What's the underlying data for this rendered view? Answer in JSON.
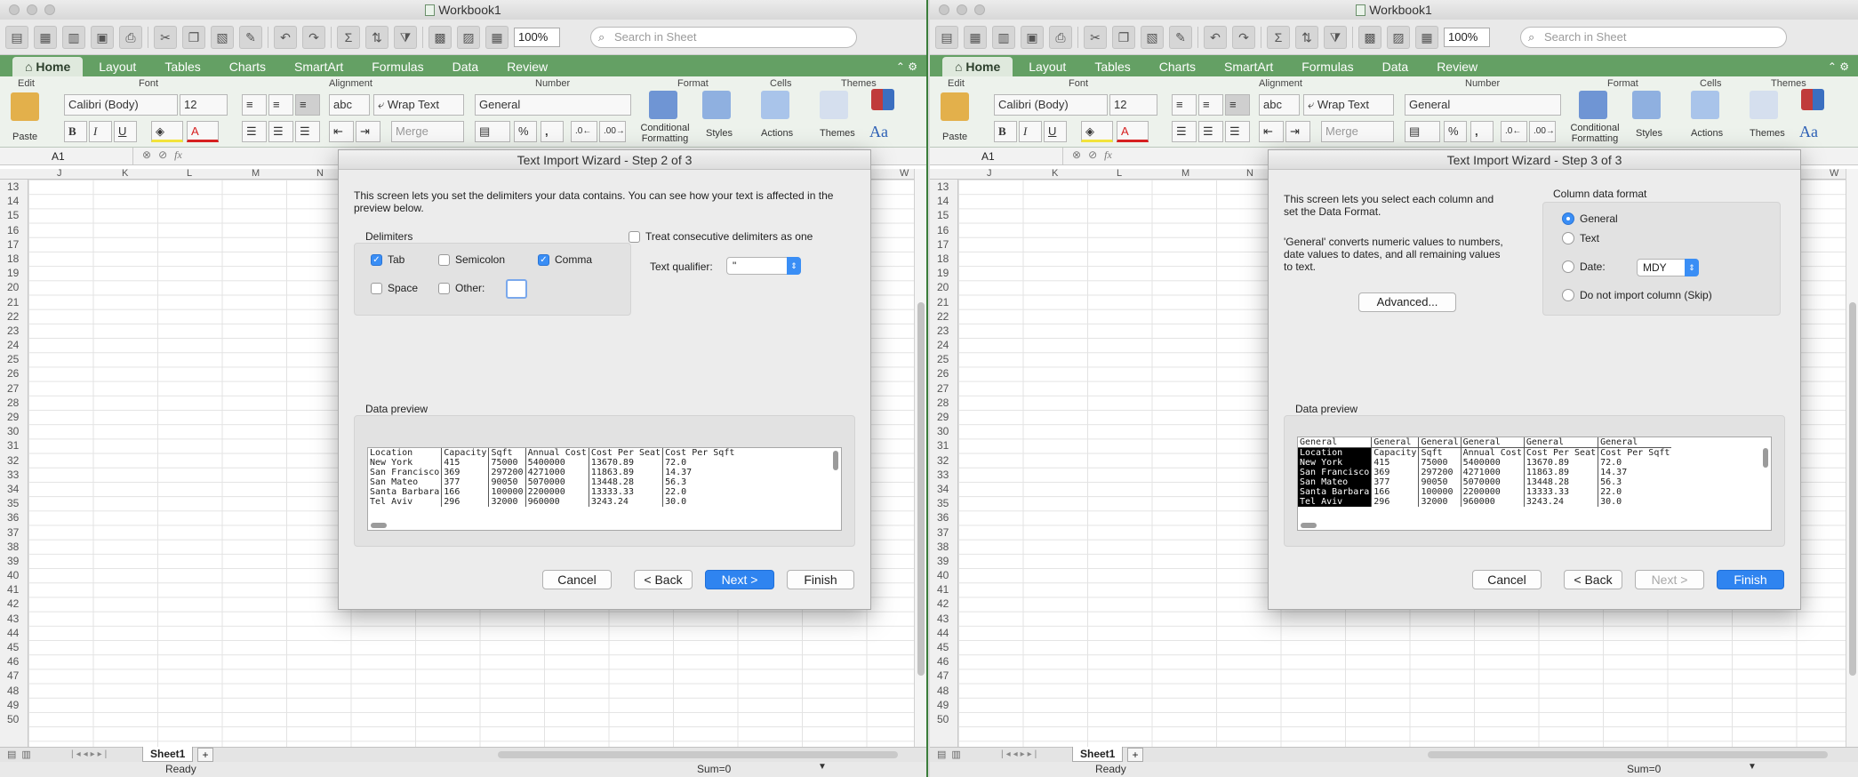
{
  "window": {
    "title": "Workbook1"
  },
  "toolbar": {
    "zoom": "100%",
    "search_placeholder": "Search in Sheet"
  },
  "ribbon": {
    "tabs": [
      "Home",
      "Layout",
      "Tables",
      "Charts",
      "SmartArt",
      "Formulas",
      "Data",
      "Review"
    ],
    "groups": [
      "Edit",
      "Font",
      "Alignment",
      "Number",
      "Format",
      "Cells",
      "Themes"
    ],
    "font_name": "Calibri (Body)",
    "font_size": "12",
    "paste_label": "Paste",
    "wrap_text_label": "Wrap Text",
    "merge_label": "Merge",
    "number_format": "General",
    "conditional_formatting_label": "Conditional Formatting",
    "styles_label": "Styles",
    "actions_label": "Actions",
    "themes_label": "Themes",
    "percent": "%",
    "comma": ",",
    "abc_label": "abc",
    "aa_label": "Aa"
  },
  "formula_bar": {
    "cell_ref": "A1",
    "fx": "fx"
  },
  "grid": {
    "columns": [
      "J",
      "K",
      "L",
      "M",
      "N"
    ],
    "right_column": "W",
    "rows": [
      "13",
      "14",
      "15",
      "16",
      "17",
      "18",
      "19",
      "20",
      "21",
      "22",
      "23",
      "24",
      "25",
      "26",
      "27",
      "28",
      "29",
      "30",
      "31",
      "32",
      "33",
      "34",
      "35",
      "36",
      "37",
      "38",
      "39",
      "40",
      "41",
      "42",
      "43",
      "44",
      "45",
      "46",
      "47",
      "48",
      "49",
      "50"
    ]
  },
  "sheet": {
    "tab": "Sheet1",
    "add": "+"
  },
  "status": {
    "ready": "Ready",
    "sum": "Sum=0"
  },
  "preview_table": {
    "header_row": [
      "General",
      "General",
      "General",
      "General",
      "General",
      "General"
    ],
    "rows": [
      [
        "Location",
        "Capacity",
        "Sqft",
        "Annual Cost",
        "Cost Per Seat",
        "Cost Per Sqft"
      ],
      [
        "New York",
        "415",
        "75000",
        "5400000",
        "13670.89",
        "72.0"
      ],
      [
        "San Francisco",
        "369",
        "297200",
        "4271000",
        "11863.89",
        "14.37"
      ],
      [
        "San Mateo",
        "377",
        "90050",
        "5070000",
        "13448.28",
        "56.3"
      ],
      [
        "Santa Barbara",
        "166",
        "100000",
        "2200000",
        "13333.33",
        "22.0"
      ],
      [
        "Tel Aviv",
        "296",
        "32000",
        "960000",
        "3243.24",
        "30.0"
      ]
    ]
  },
  "dialog_step2": {
    "title": "Text Import Wizard - Step 2 of 3",
    "description": "This screen lets you set the delimiters your data contains.  You can see how your text is affected in the preview below.",
    "delimiters_label": "Delimiters",
    "tab": "Tab",
    "semicolon": "Semicolon",
    "comma": "Comma",
    "space": "Space",
    "other": "Other:",
    "consecutive": "Treat consecutive delimiters as one",
    "qualifier_label": "Text qualifier:",
    "qualifier_value": "\"",
    "preview_label": "Data preview",
    "cancel": "Cancel",
    "back": "< Back",
    "next": "Next >",
    "finish": "Finish"
  },
  "dialog_step3": {
    "title": "Text Import Wizard - Step 3 of 3",
    "description1": "This screen lets you select each column and set the Data Format.",
    "description2": "'General' converts numeric values to numbers, date values to dates, and all remaining values to text.",
    "advanced": "Advanced...",
    "format_label": "Column data format",
    "general": "General",
    "text": "Text",
    "date": "Date:",
    "date_value": "MDY",
    "skip": "Do not import column (Skip)",
    "preview_label": "Data preview",
    "cancel": "Cancel",
    "back": "< Back",
    "next": "Next >",
    "finish": "Finish"
  },
  "colors": {
    "ribbon_tab_bar": "#64a064",
    "ribbon_body": "#edf2ec",
    "primary_button": "#2f84f0"
  }
}
